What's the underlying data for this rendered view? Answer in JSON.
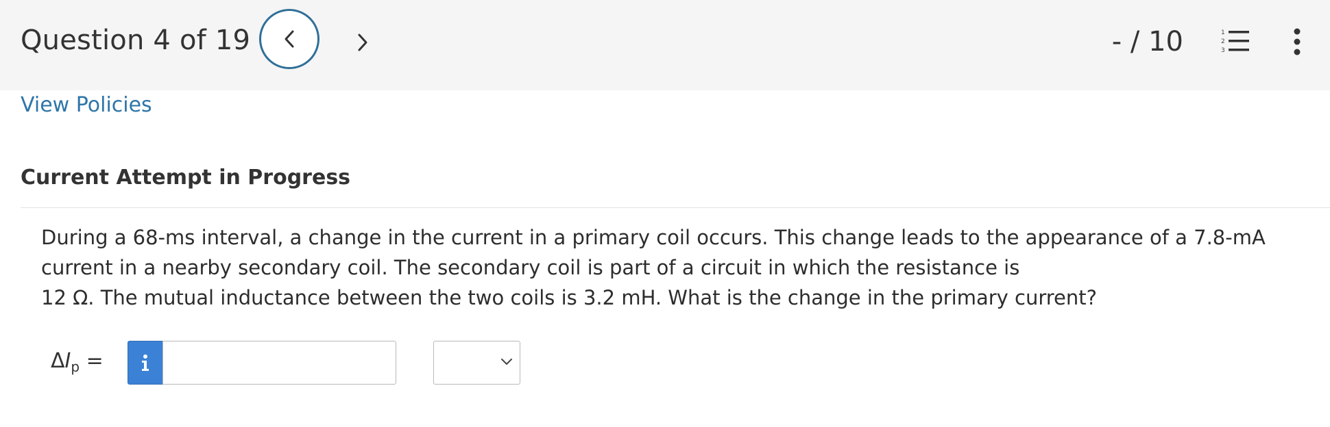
{
  "header": {
    "question_label": "Question 4 of 19",
    "score": "- / 10",
    "icons": {
      "prev": "chevron-left-icon",
      "next": "chevron-right-icon",
      "list": "numbered-list-icon",
      "menu": "more-vertical-icon"
    },
    "colors": {
      "accent": "#2f6f98",
      "background": "#f5f5f5"
    }
  },
  "links": {
    "view_policies": "View Policies"
  },
  "status": {
    "attempt": "Current Attempt in Progress"
  },
  "question": {
    "line1": "During a 68-ms interval, a change in the current in a primary coil occurs. This change leads to the appearance of a 7.8-mA current in a nearby secondary coil. The secondary coil is part of a circuit in which the resistance is",
    "line2": "12 Ω. The mutual inductance between the two coils is 3.2 mH. What is the change in the primary current?"
  },
  "answer": {
    "label_prefix": "Δ",
    "label_var": "I",
    "label_sub": "p",
    "label_suffix": " =",
    "info_glyph": "i",
    "input_value": "",
    "input_placeholder": "",
    "unit_selected": "",
    "info_color": "#3b82d6"
  }
}
